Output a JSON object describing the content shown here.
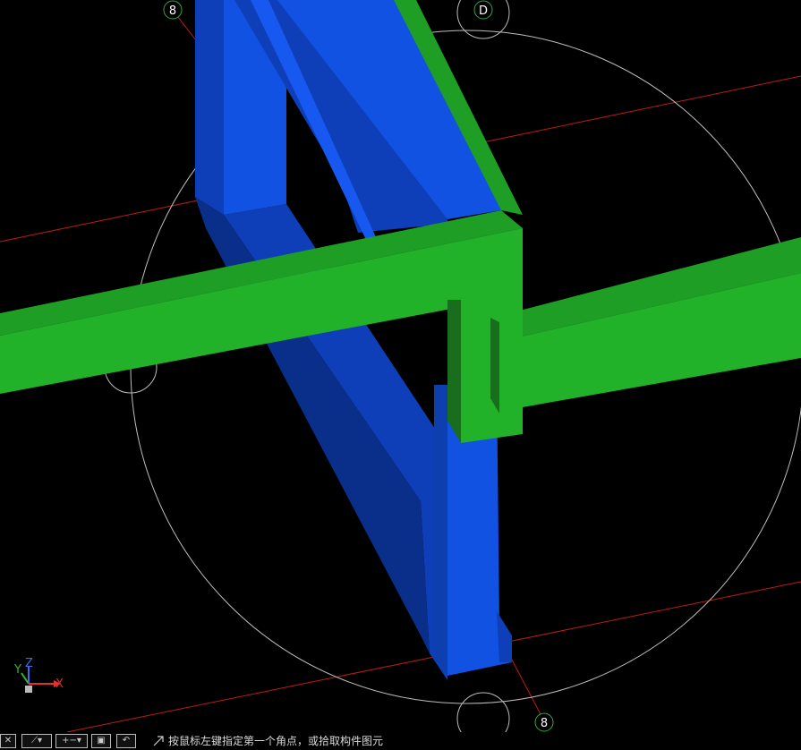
{
  "viewport": {
    "axis_markers": {
      "top_left": "8",
      "top_mid": "D",
      "bottom_right": "8"
    },
    "ucs": {
      "x_label": "X",
      "y_label": "Y",
      "z_label": "Z"
    }
  },
  "colors": {
    "background": "#000000",
    "beam_green": "#22b22a",
    "column_blue": "#1152e3",
    "grid_red": "#c21a1a",
    "circle_gray": "#bdbdbd"
  },
  "statusbar": {
    "prompt": "按鼠标左键指定第一个角点，或拾取构件图元",
    "tools": [
      "close-icon",
      "line-tool-icon",
      "plus-minus-icon",
      "box-icon",
      "rotate-icon"
    ]
  }
}
